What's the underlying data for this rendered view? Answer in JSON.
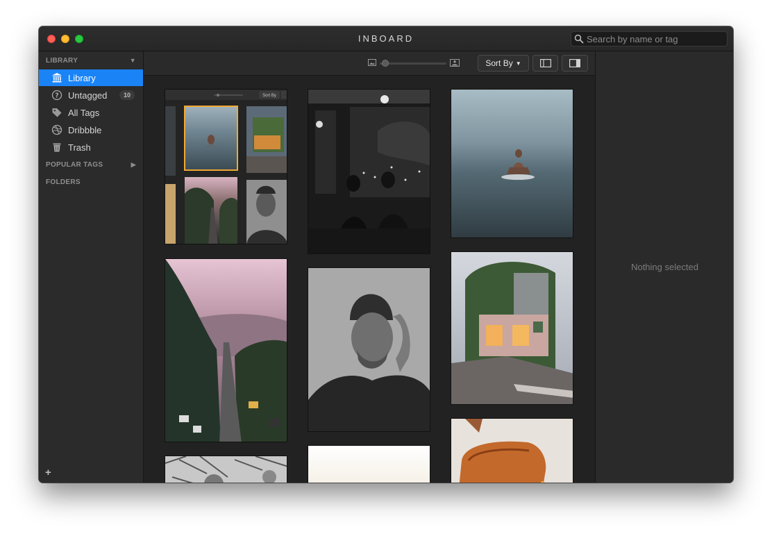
{
  "window": {
    "title": "INBOARD"
  },
  "search": {
    "placeholder": "Search by name or tag",
    "icon": "search-icon"
  },
  "sidebar": {
    "library_header": "LIBRARY",
    "items": [
      {
        "label": "Library",
        "icon": "library-icon",
        "active": true
      },
      {
        "label": "Untagged",
        "icon": "question-icon",
        "badge": "10"
      },
      {
        "label": "All Tags",
        "icon": "tag-icon"
      },
      {
        "label": "Dribbble",
        "icon": "dribbble-icon"
      },
      {
        "label": "Trash",
        "icon": "trash-icon"
      }
    ],
    "popular_tags_header": "POPULAR TAGS",
    "folders_header": "FOLDERS",
    "add_label": "+"
  },
  "toolbar": {
    "sort_label": "Sort By",
    "zoom_level": 0.04
  },
  "mini_toolbar": {
    "sort_label": "Sort By"
  },
  "detail": {
    "empty_text": "Nothing selected"
  },
  "colors": {
    "accent": "#1a84f7",
    "selection_border": "#f0a935"
  }
}
